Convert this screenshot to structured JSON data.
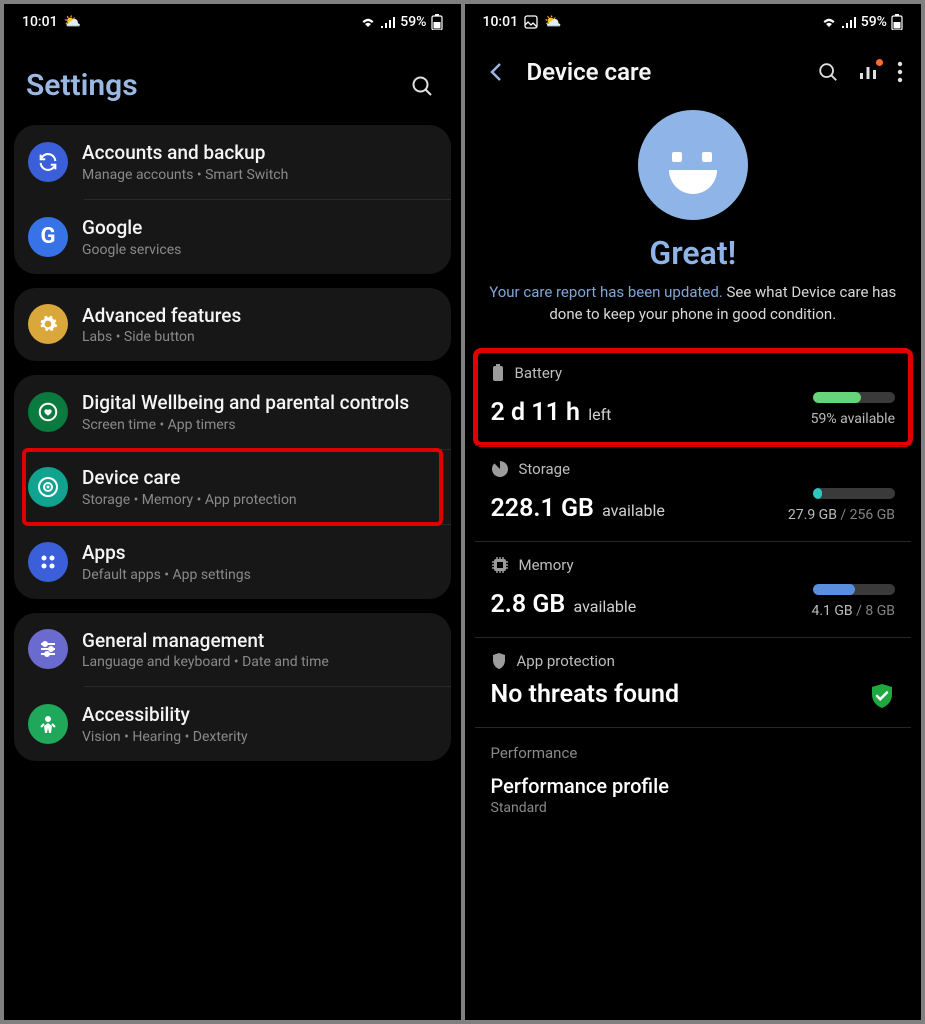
{
  "status": {
    "time": "10:01",
    "battery_pct": "59%"
  },
  "left": {
    "title": "Settings",
    "groups": [
      {
        "items": [
          {
            "key": "accounts",
            "title": "Accounts and backup",
            "sub": "Manage accounts  •  Smart Switch",
            "icon": "sync",
            "bg": "bg-blue-sync"
          },
          {
            "key": "google",
            "title": "Google",
            "sub": "Google services",
            "icon": "google",
            "bg": "bg-google"
          }
        ]
      },
      {
        "items": [
          {
            "key": "advanced",
            "title": "Advanced features",
            "sub": "Labs  •  Side button",
            "icon": "gear",
            "bg": "bg-yellow"
          }
        ]
      },
      {
        "items": [
          {
            "key": "wellbeing",
            "title": "Digital Wellbeing and parental controls",
            "sub": "Screen time  •  App timers",
            "icon": "heart",
            "bg": "bg-green-heart"
          },
          {
            "key": "devicecare",
            "title": "Device care",
            "sub": "Storage  •  Memory  •  App protection",
            "icon": "care",
            "bg": "bg-teal",
            "highlight": true
          },
          {
            "key": "apps",
            "title": "Apps",
            "sub": "Default apps  •  App settings",
            "icon": "apps",
            "bg": "bg-blue-apps"
          }
        ]
      },
      {
        "items": [
          {
            "key": "general",
            "title": "General management",
            "sub": "Language and keyboard  •  Date and time",
            "icon": "sliders",
            "bg": "bg-purple"
          },
          {
            "key": "accessibility",
            "title": "Accessibility",
            "sub": "Vision  •  Hearing  •  Dexterity",
            "icon": "person",
            "bg": "bg-green-acc"
          }
        ]
      }
    ]
  },
  "right": {
    "title": "Device care",
    "hero": {
      "status": "Great!",
      "link_text": "Your care report has been updated.",
      "desc_rest": " See what Device care has done to keep your phone in good condition."
    },
    "battery": {
      "label": "Battery",
      "time_left_value": "2 d 11 h",
      "time_left_unit": "left",
      "available": "59% available",
      "highlight": true
    },
    "storage": {
      "label": "Storage",
      "value": "228.1 GB",
      "unit": "available",
      "used": "27.9 GB",
      "total": "256 GB"
    },
    "memory": {
      "label": "Memory",
      "value": "2.8 GB",
      "unit": "available",
      "used": "4.1 GB",
      "total": "8 GB"
    },
    "protection": {
      "label": "App protection",
      "status": "No threats found"
    },
    "performance": {
      "section": "Performance",
      "title": "Performance profile",
      "value": "Standard"
    }
  }
}
